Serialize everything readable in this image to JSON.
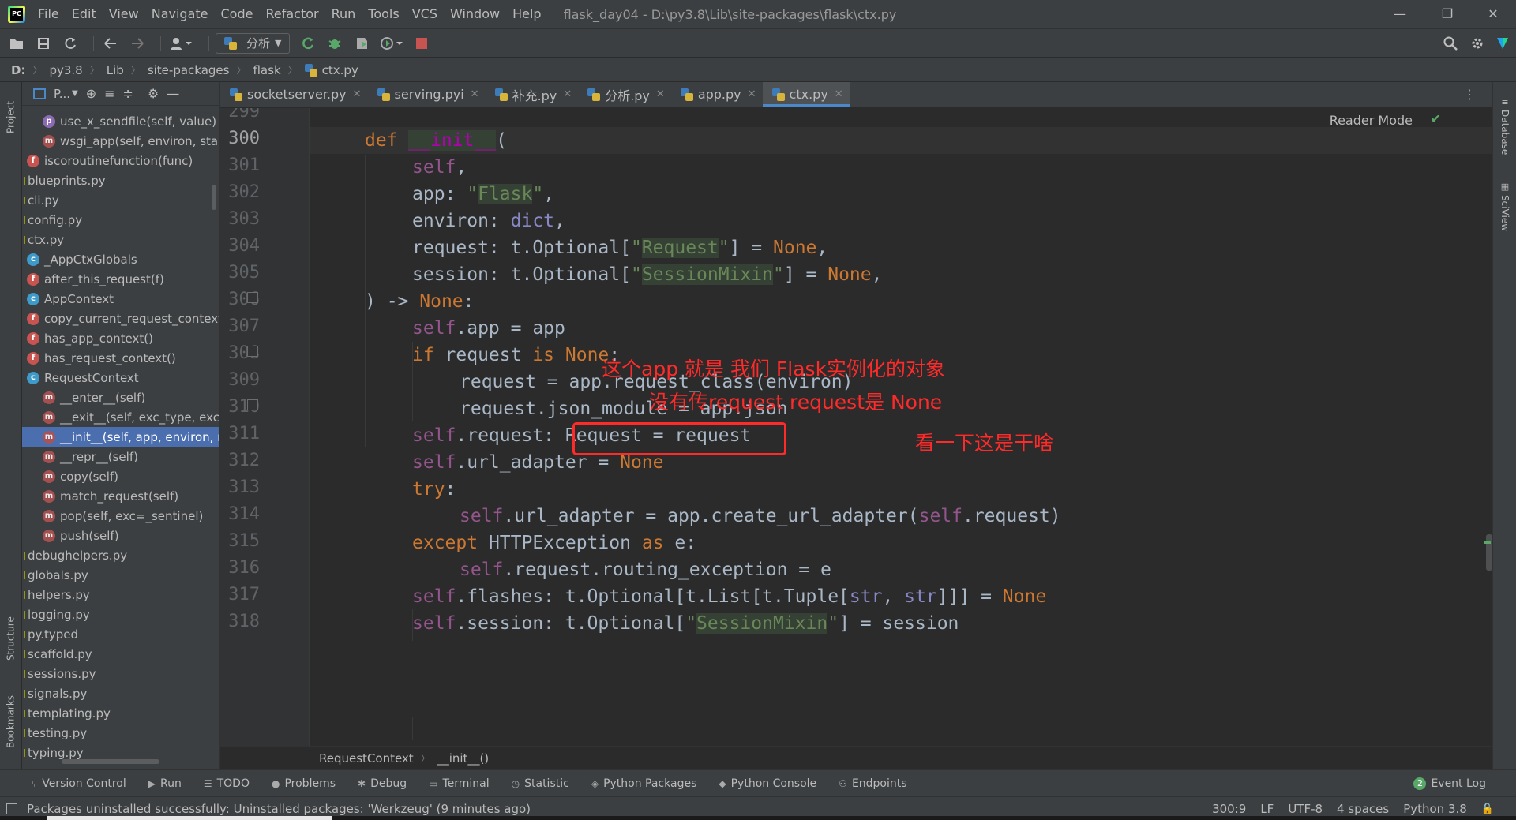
{
  "menubar": {
    "items": [
      "File",
      "Edit",
      "View",
      "Navigate",
      "Code",
      "Refactor",
      "Run",
      "Tools",
      "VCS",
      "Window",
      "Help"
    ],
    "title": "flask_day04 - D:\\py3.8\\Lib\\site-packages\\flask\\ctx.py",
    "minimize": "—",
    "restore": "❐",
    "close": "✕"
  },
  "toolbar": {
    "run_config": "分析"
  },
  "navbar": {
    "crumbs": [
      "D:",
      "py3.8",
      "Lib",
      "site-packages",
      "flask",
      "ctx.py"
    ]
  },
  "left_strip": {
    "project": "Project",
    "structure": "Structure",
    "bookmarks": "Bookmarks"
  },
  "right_strip": {
    "database": "Database",
    "sciview": "SciView"
  },
  "project_panel": {
    "title": "P...",
    "tree": [
      {
        "icon": "p",
        "label": "use_x_sendfile(self, value)",
        "indent": 2
      },
      {
        "icon": "m",
        "label": "wsgi_app(self, environ, start_response)",
        "indent": 2
      },
      {
        "icon": "f",
        "label": "iscoroutinefunction(func)",
        "indent": 1
      },
      {
        "icon": "file",
        "label": "blueprints.py",
        "indent": 0
      },
      {
        "icon": "file",
        "label": "cli.py",
        "indent": 0
      },
      {
        "icon": "file",
        "label": "config.py",
        "indent": 0
      },
      {
        "icon": "file",
        "label": "ctx.py",
        "indent": 0
      },
      {
        "icon": "c",
        "label": "_AppCtxGlobals",
        "indent": 1
      },
      {
        "icon": "f",
        "label": "after_this_request(f)",
        "indent": 1
      },
      {
        "icon": "c",
        "label": "AppContext",
        "indent": 1
      },
      {
        "icon": "f",
        "label": "copy_current_request_context(f)",
        "indent": 1
      },
      {
        "icon": "f",
        "label": "has_app_context()",
        "indent": 1
      },
      {
        "icon": "f",
        "label": "has_request_context()",
        "indent": 1
      },
      {
        "icon": "c",
        "label": "RequestContext",
        "indent": 1
      },
      {
        "icon": "m",
        "label": "__enter__(self)",
        "indent": 2
      },
      {
        "icon": "m",
        "label": "__exit__(self, exc_type, exc_value, tb)",
        "indent": 2
      },
      {
        "icon": "m",
        "label": "__init__(self, app, environ, request, session)",
        "indent": 2,
        "selected": true
      },
      {
        "icon": "m",
        "label": "__repr__(self)",
        "indent": 2
      },
      {
        "icon": "m",
        "label": "copy(self)",
        "indent": 2
      },
      {
        "icon": "m",
        "label": "match_request(self)",
        "indent": 2
      },
      {
        "icon": "m",
        "label": "pop(self, exc=_sentinel)",
        "indent": 2
      },
      {
        "icon": "m",
        "label": "push(self)",
        "indent": 2
      },
      {
        "icon": "file",
        "label": "debughelpers.py",
        "indent": 0
      },
      {
        "icon": "file",
        "label": "globals.py",
        "indent": 0
      },
      {
        "icon": "file",
        "label": "helpers.py",
        "indent": 0
      },
      {
        "icon": "file",
        "label": "logging.py",
        "indent": 0
      },
      {
        "icon": "file",
        "label": "py.typed",
        "indent": 0
      },
      {
        "icon": "file",
        "label": "scaffold.py",
        "indent": 0
      },
      {
        "icon": "file",
        "label": "sessions.py",
        "indent": 0
      },
      {
        "icon": "file",
        "label": "signals.py",
        "indent": 0
      },
      {
        "icon": "file",
        "label": "templating.py",
        "indent": 0
      },
      {
        "icon": "file",
        "label": "testing.py",
        "indent": 0
      },
      {
        "icon": "file",
        "label": "typing.py",
        "indent": 0
      }
    ]
  },
  "tabs": [
    {
      "label": "socketserver.py",
      "active": false
    },
    {
      "label": "serving.pyi",
      "active": false
    },
    {
      "label": "补充.py",
      "active": false
    },
    {
      "label": "分析.py",
      "active": false
    },
    {
      "label": "app.py",
      "active": false
    },
    {
      "label": "ctx.py",
      "active": true
    }
  ],
  "editor": {
    "reader_mode": "Reader Mode",
    "line_numbers": [
      "299",
      "300",
      "301",
      "302",
      "303",
      "304",
      "305",
      "306",
      "307",
      "308",
      "309",
      "310",
      "311",
      "312",
      "313",
      "314",
      "315",
      "316",
      "317",
      "318"
    ],
    "current_line": "300",
    "annotations": {
      "line307": "这个app 就是 我们 Flask实例化的对象",
      "line308": "没有传request  request是 None",
      "line309": "看一下这是干啥"
    },
    "breadcrumb": [
      "RequestContext",
      "__init__()"
    ]
  },
  "tool_windows": [
    {
      "label": "Version Control",
      "icon": "branch-icon"
    },
    {
      "label": "Run",
      "icon": "run-icon"
    },
    {
      "label": "TODO",
      "icon": "list-icon"
    },
    {
      "label": "Problems",
      "icon": "warning-icon"
    },
    {
      "label": "Debug",
      "icon": "bug-icon"
    },
    {
      "label": "Terminal",
      "icon": "terminal-icon"
    },
    {
      "label": "Statistic",
      "icon": "clock-icon"
    },
    {
      "label": "Python Packages",
      "icon": "package-icon"
    },
    {
      "label": "Python Console",
      "icon": "python-icon"
    },
    {
      "label": "Endpoints",
      "icon": "endpoints-icon"
    }
  ],
  "event_log": {
    "count": "2",
    "label": "Event Log"
  },
  "status": {
    "message": "Packages uninstalled successfully: Uninstalled packages: 'Werkzeug' (9 minutes ago)",
    "position": "300:9",
    "line_sep": "LF",
    "encoding": "UTF-8",
    "indent": "4 spaces",
    "interpreter": "Python 3.8"
  },
  "colors": {
    "annotation": "#ff2a2a",
    "selection": "#4b6eaf",
    "keyword": "#cc7832",
    "string": "#6a8759"
  }
}
